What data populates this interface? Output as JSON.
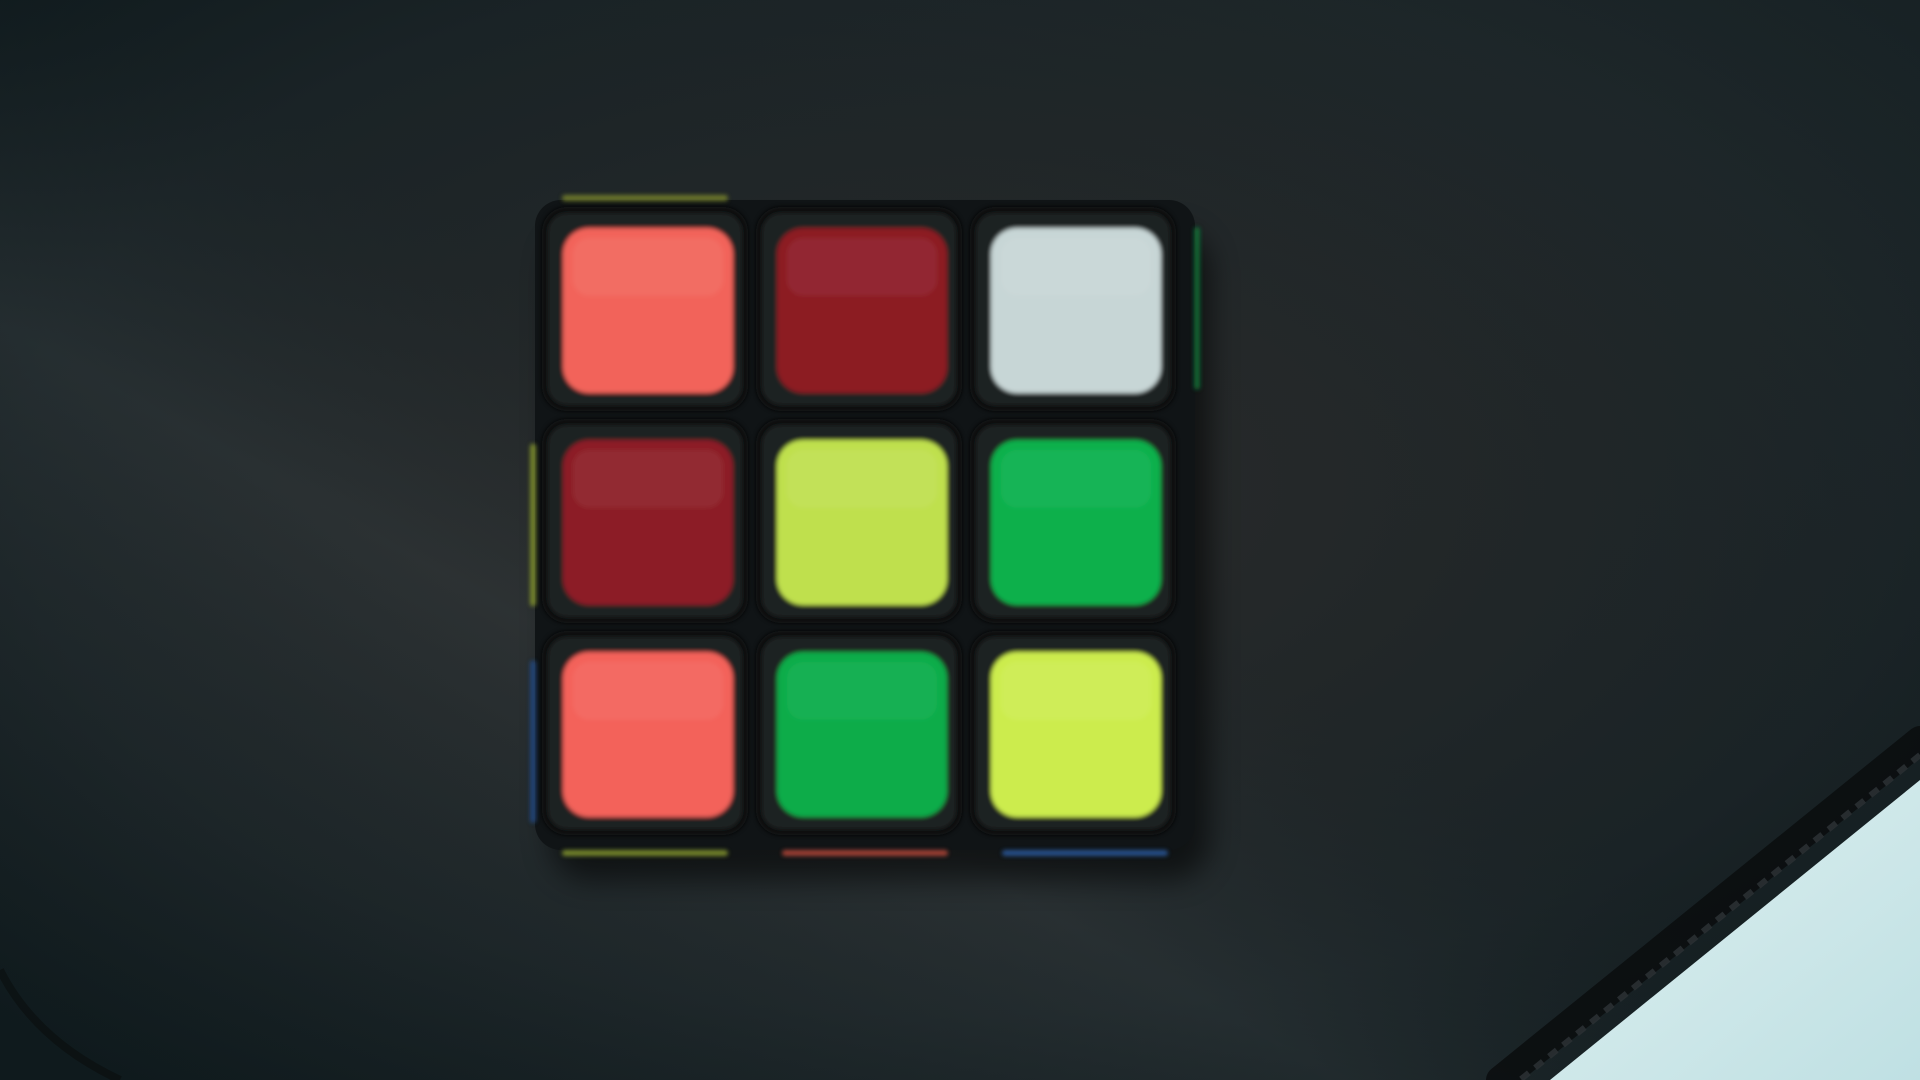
{
  "scene": {
    "subject": "cube-face",
    "background_color": "#141d20",
    "mat_color": "#1a1f22",
    "table_color": "#cfe6e8",
    "plastic_color": "#101416"
  },
  "cube_face": {
    "rows": 3,
    "cols": 3,
    "stickers": [
      {
        "row": 0,
        "col": 0,
        "color_name": "orange",
        "color": "#f2645a"
      },
      {
        "row": 0,
        "col": 1,
        "color_name": "red",
        "color": "#8c1a24"
      },
      {
        "row": 0,
        "col": 2,
        "color_name": "white",
        "color": "#c7d6d6"
      },
      {
        "row": 1,
        "col": 0,
        "color_name": "red",
        "color": "#8c1f25"
      },
      {
        "row": 1,
        "col": 1,
        "color_name": "yellow",
        "color": "#bfe04e"
      },
      {
        "row": 1,
        "col": 2,
        "color_name": "green",
        "color": "#0bb04c"
      },
      {
        "row": 2,
        "col": 0,
        "color_name": "orange",
        "color": "#f3625a"
      },
      {
        "row": 2,
        "col": 1,
        "color_name": "green",
        "color": "#07ac48"
      },
      {
        "row": 2,
        "col": 2,
        "color_name": "yellow",
        "color": "#ccec4e"
      }
    ],
    "edge_hints": [
      {
        "side": "top",
        "index": 0,
        "color": "#7f8b2a"
      },
      {
        "side": "right",
        "index": 0,
        "color": "#0e7a3a"
      },
      {
        "side": "left",
        "index": 1,
        "color": "#8a9b2c"
      },
      {
        "side": "left",
        "index": 2,
        "color": "#214a8a"
      },
      {
        "side": "bottom",
        "index": 0,
        "color": "#8ea22f"
      },
      {
        "side": "bottom",
        "index": 1,
        "color": "#c24c3c"
      },
      {
        "side": "bottom",
        "index": 2,
        "color": "#2c5ea8"
      }
    ]
  }
}
